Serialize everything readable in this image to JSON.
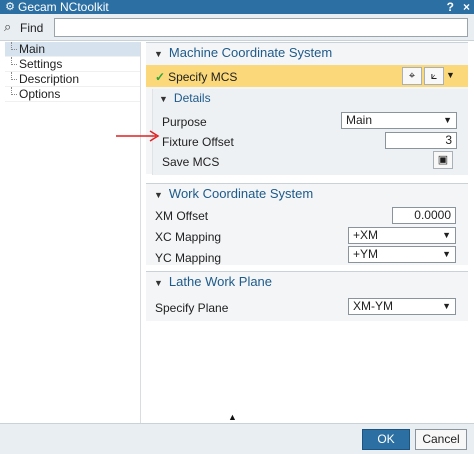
{
  "window": {
    "title": "Gecam NCtoolkit",
    "help": "?",
    "close": "×",
    "app_icon": "gear-icon"
  },
  "find": {
    "label": "Find",
    "value": ""
  },
  "sidebar": {
    "items": [
      {
        "label": "Main",
        "selected": true
      },
      {
        "label": "Settings"
      },
      {
        "label": "Description"
      },
      {
        "label": "Options"
      }
    ]
  },
  "mcs": {
    "header": "Machine Coordinate System",
    "specify_label": "Specify MCS",
    "details_header": "Details",
    "purpose_label": "Purpose",
    "purpose_value": "Main",
    "fixture_label": "Fixture Offset",
    "fixture_value": "3",
    "save_label": "Save MCS"
  },
  "wcs": {
    "header": "Work Coordinate System",
    "xm_label": "XM Offset",
    "xm_value": "0.0000",
    "xc_label": "XC Mapping",
    "xc_value": "+XM",
    "yc_label": "YC Mapping",
    "yc_value": "+YM"
  },
  "lathe": {
    "header": "Lathe Work Plane",
    "plane_label": "Specify Plane",
    "plane_value": "XM-YM"
  },
  "footer": {
    "ok": "OK",
    "cancel": "Cancel"
  },
  "colors": {
    "titlebar": "#2b6fa3",
    "highlight": "#fbd97a",
    "header_text": "#1e5a8a",
    "annotation": "#e02020"
  }
}
